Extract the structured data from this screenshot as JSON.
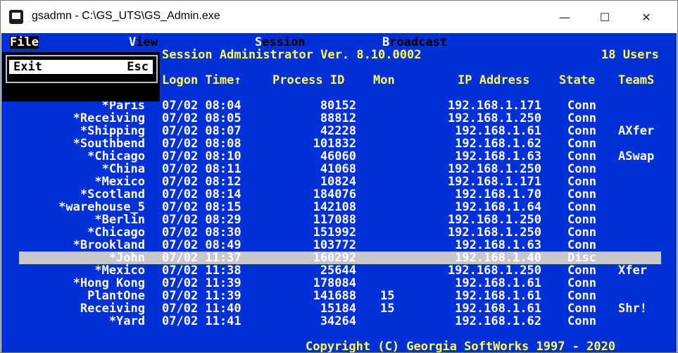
{
  "window": {
    "title": "gsadmn - C:\\GS_UTS\\GS_Admin.exe",
    "minimize": "—",
    "maximize": "☐",
    "close": "✕"
  },
  "menu": {
    "file": "File",
    "view_hk": "V",
    "view_rest": "iew",
    "session_hk": "S",
    "session_rest": "ession",
    "broadcast_hk": "B",
    "broadcast_rest": "roadcast"
  },
  "file_menu": {
    "exit_label": "Exit",
    "exit_shortcut": "Esc"
  },
  "header": {
    "title": "Session Administrator Ver. 8.10.0002",
    "users": "18 Users"
  },
  "columns": {
    "logon": "Logon Time↑",
    "pid": "Process ID",
    "mon": "Mon",
    "ip": "IP Address",
    "state": "State",
    "teams": "TeamS"
  },
  "sessions": [
    {
      "name": "*Paris",
      "time": "07/02 08:04",
      "pid": "80152",
      "mon": "",
      "ip": "192.168.1.171",
      "state": "Conn",
      "team": ""
    },
    {
      "name": "*Receiving",
      "time": "07/02 08:05",
      "pid": "88812",
      "mon": "",
      "ip": "192.168.1.250",
      "state": "Conn",
      "team": ""
    },
    {
      "name": "*Shipping",
      "time": "07/02 08:07",
      "pid": "42228",
      "mon": "",
      "ip": "192.168.1.61",
      "state": "Conn",
      "team": "AXfer"
    },
    {
      "name": "*Southbend",
      "time": "07/02 08:08",
      "pid": "101832",
      "mon": "",
      "ip": "192.168.1.62",
      "state": "Conn",
      "team": ""
    },
    {
      "name": "*Chicago",
      "time": "07/02 08:10",
      "pid": "46060",
      "mon": "",
      "ip": "192.168.1.63",
      "state": "Conn",
      "team": "ASwap"
    },
    {
      "name": "*China",
      "time": "07/02 08:11",
      "pid": "41068",
      "mon": "",
      "ip": "192.168.1.250",
      "state": "Conn",
      "team": ""
    },
    {
      "name": "*Mexico",
      "time": "07/02 08:12",
      "pid": "10824",
      "mon": "",
      "ip": "192.168.1.171",
      "state": "Conn",
      "team": ""
    },
    {
      "name": "*Scotland",
      "time": "07/02 08:14",
      "pid": "184076",
      "mon": "",
      "ip": "192.168.1.70",
      "state": "Conn",
      "team": ""
    },
    {
      "name": "*warehouse_5",
      "time": "07/02 08:15",
      "pid": "142108",
      "mon": "",
      "ip": "192.168.1.64",
      "state": "Conn",
      "team": ""
    },
    {
      "name": "*Berlin",
      "time": "07/02 08:29",
      "pid": "117088",
      "mon": "",
      "ip": "192.168.1.250",
      "state": "Conn",
      "team": ""
    },
    {
      "name": "*Chicago",
      "time": "07/02 08:30",
      "pid": "151992",
      "mon": "",
      "ip": "192.168.1.250",
      "state": "Conn",
      "team": ""
    },
    {
      "name": "*Brookland",
      "time": "07/02 08:49",
      "pid": "103772",
      "mon": "",
      "ip": "192.168.1.63",
      "state": "Conn",
      "team": ""
    },
    {
      "name": "*John",
      "time": "07/02 11:37",
      "pid": "160292",
      "mon": "",
      "ip": "192.168.1.40",
      "state": "Disc",
      "team": "",
      "selected": true
    },
    {
      "name": "*Mexico",
      "time": "07/02 11:38",
      "pid": "25644",
      "mon": "",
      "ip": "192.168.1.250",
      "state": "Conn",
      "team": "Xfer"
    },
    {
      "name": "*Hong Kong",
      "time": "07/02 11:39",
      "pid": "178084",
      "mon": "",
      "ip": "192.168.1.61",
      "state": "Conn",
      "team": ""
    },
    {
      "name": "PlantOne",
      "time": "07/02 11:39",
      "pid": "141688",
      "mon": "15",
      "ip": "192.168.1.61",
      "state": "Conn",
      "team": ""
    },
    {
      "name": "Receiving",
      "time": "07/02 11:40",
      "pid": "15184",
      "mon": "15",
      "ip": "192.168.1.61",
      "state": "Conn",
      "team": "Shr!"
    },
    {
      "name": "*Yard",
      "time": "07/02 11:41",
      "pid": "34264",
      "mon": "",
      "ip": "192.168.1.62",
      "state": "Conn",
      "team": ""
    }
  ],
  "footer": {
    "copyright": "Copyright (C) Georgia SoftWorks 1997 - 2020"
  },
  "colors": {
    "console_bg": "#0030d8",
    "text": "#ffffff",
    "accent": "#ffff55",
    "selection": "#c8c8c8"
  }
}
